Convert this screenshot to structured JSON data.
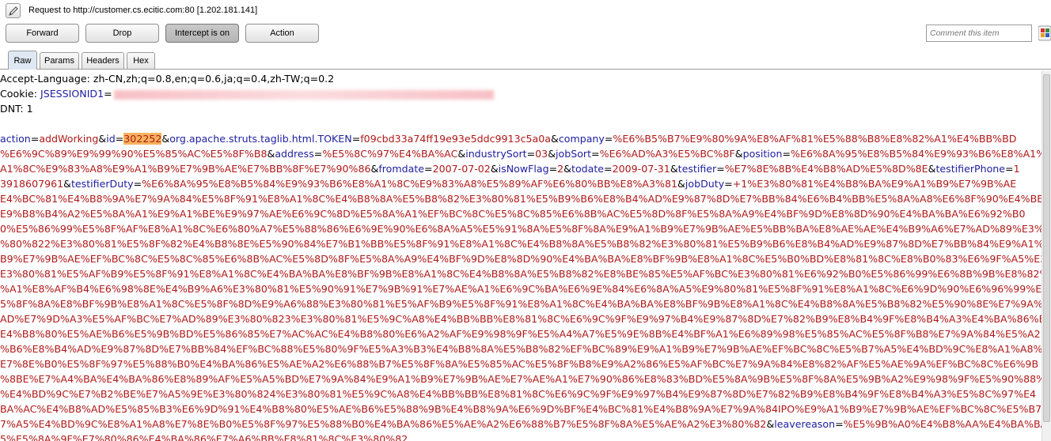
{
  "header": {
    "title": "Request to http://customer.cs.ecitic.com:80  [1.202.181.141]"
  },
  "toolbar": {
    "forward_label": "Forward",
    "drop_label": "Drop",
    "intercept_label": "Intercept is on",
    "action_label": "Action",
    "comment_placeholder": "Comment this item"
  },
  "tabs": [
    {
      "label": "Raw",
      "active": true
    },
    {
      "label": "Params",
      "active": false
    },
    {
      "label": "Headers",
      "active": false
    },
    {
      "label": "Hex",
      "active": false
    }
  ],
  "request": {
    "header_lines": [
      "Accept-Language: zh-CN,zh;q=0.8,en;q=0.6,ja;q=0.4,zh-TW;q=0.2",
      "Cookie: ",
      "DNT: 1"
    ],
    "cookie_name": "JSESSIONID1",
    "cookie_value_redacted": true,
    "highlighted_value": "302252",
    "body_lines": [
      [
        [
          "k",
          "action"
        ],
        [
          "e",
          "="
        ],
        [
          "v",
          "addWorking"
        ],
        [
          "e",
          "&"
        ],
        [
          "k",
          "id"
        ],
        [
          "e",
          "="
        ],
        [
          "h",
          "302252"
        ],
        [
          "e",
          "&"
        ],
        [
          "k",
          "org.apache.struts.taglib.html.TOKEN"
        ],
        [
          "e",
          "="
        ],
        [
          "v",
          "f09cbd33a74ff19e93e5ddc9913c5a0a"
        ],
        [
          "e",
          "&"
        ],
        [
          "k",
          "company"
        ],
        [
          "e",
          "="
        ],
        [
          "v",
          "%E6%B5%B7%E9%80%9A%E8%AF%81%E5%88%B8%E8%82%A1%E4%BB%BD"
        ]
      ],
      [
        [
          "v",
          "%E6%9C%89%E9%99%90%E5%85%AC%E5%8F%B8"
        ],
        [
          "e",
          "&"
        ],
        [
          "k",
          "address"
        ],
        [
          "e",
          "="
        ],
        [
          "v",
          "%E5%8C%97%E4%BA%AC"
        ],
        [
          "e",
          "&"
        ],
        [
          "k",
          "industrySort"
        ],
        [
          "e",
          "="
        ],
        [
          "v",
          "03"
        ],
        [
          "e",
          "&"
        ],
        [
          "k",
          "jobSort"
        ],
        [
          "e",
          "="
        ],
        [
          "v",
          "%E6%AD%A3%E5%BC%8F"
        ],
        [
          "e",
          "&"
        ],
        [
          "k",
          "position"
        ],
        [
          "e",
          "="
        ],
        [
          "v",
          "%E6%8A%95%E8%B5%84%E9%93%B6%E8%A1%8C"
        ]
      ],
      [
        [
          "v",
          "A1%8C%E9%83%A8%E9%A1%B9%E7%9B%AE%E7%BB%8F%E7%90%86"
        ],
        [
          "e",
          "&"
        ],
        [
          "k",
          "fromdate"
        ],
        [
          "e",
          "="
        ],
        [
          "v",
          "2007-07-02"
        ],
        [
          "e",
          "&"
        ],
        [
          "k",
          "isNowFlag"
        ],
        [
          "e",
          "="
        ],
        [
          "v",
          "2"
        ],
        [
          "e",
          "&"
        ],
        [
          "k",
          "todate"
        ],
        [
          "e",
          "="
        ],
        [
          "v",
          "2009-07-31"
        ],
        [
          "e",
          "&"
        ],
        [
          "k",
          "testifier"
        ],
        [
          "e",
          "="
        ],
        [
          "v",
          "%E7%8E%8B%E4%B8%AD%E5%8D%8E"
        ],
        [
          "e",
          "&"
        ],
        [
          "k",
          "testifierPhone"
        ],
        [
          "e",
          "="
        ],
        [
          "v",
          "1"
        ]
      ],
      [
        [
          "v",
          "3918607961"
        ],
        [
          "e",
          "&"
        ],
        [
          "k",
          "testifierDuty"
        ],
        [
          "e",
          "="
        ],
        [
          "v",
          "%E6%8A%95%E8%B5%84%E9%93%B6%E8%A1%8C%E9%83%A8%E5%89%AF%E6%80%BB%E8%A3%81"
        ],
        [
          "e",
          "&"
        ],
        [
          "k",
          "jobDuty"
        ],
        [
          "e",
          "="
        ],
        [
          "v",
          "+1%E3%80%81%E4%B8%BA%E9%A1%B9%E7%9B%AE"
        ]
      ],
      [
        [
          "v",
          "E4%BC%81%E4%B8%9A%E7%9A%84%E5%8F%91%E8%A1%8C%E4%B8%8A%E5%B8%82%E3%80%81%E5%B9%B6%E8%B4%AD%E9%87%8D%E7%BB%84%E6%B4%BB%E5%8A%A8%E6%8F%90%E4%BE%9B"
        ]
      ],
      [
        [
          "v",
          "E9%B8%B4%A2%E5%8A%A1%E9%A1%BE%E9%97%AE%E6%9C%8D%E5%8A%A1%EF%BC%8C%E5%8C%85%E6%8B%AC%E5%8D%8F%E5%8A%A9%E4%BF%9D%E8%8D%90%E4%BA%BA%E6%92%B0"
        ]
      ],
      [
        [
          "v",
          "0%E5%86%99%E5%8F%AF%E8%A1%8C%E6%80%A7%E5%88%86%E6%9E%90%E6%8A%A5%E5%91%8A%E5%8F%8A%E9%A1%B9%E7%9B%AE%E5%BB%BA%E8%AE%AE%E4%B9%A6%E7%AD%89%E3%80"
        ]
      ],
      [
        [
          "v",
          "%80%822%E3%80%81%E5%8F%82%E4%B8%8E%E5%90%84%E7%B1%BB%E5%8F%91%E8%A1%8C%E4%B8%8A%E5%B8%82%E3%80%81%E5%B9%B6%E8%B4%AD%E9%87%8D%E7%BB%84%E9%A1%B9"
        ]
      ],
      [
        [
          "v",
          "B9%E7%9B%AE%EF%BC%8C%E5%8C%85%E6%8B%AC%E5%8D%8F%E5%8A%A9%E4%BF%9D%E8%8D%90%E4%BA%BA%E8%BF%9B%E8%A1%8C%E5%B0%BD%E8%81%8C%E8%B0%83%E6%9F%A5%E3"
        ]
      ],
      [
        [
          "v",
          "E3%80%81%E5%AF%B9%E5%8F%91%E8%A1%8C%E4%BA%BA%E8%BF%9B%E8%A1%8C%E4%B8%8A%E5%B8%82%E8%BE%85%E5%AF%BC%E3%80%81%E6%92%B0%E5%86%99%E6%8B%9B%E8%82%A1"
        ]
      ],
      [
        [
          "v",
          "%A1%E8%AF%B4%E6%98%8E%E4%B9%A6%E3%80%81%E5%90%91%E7%9B%91%E7%AE%A1%E6%9C%BA%E6%9E%84%E6%8A%A5%E9%80%81%E5%8F%91%E8%A1%8C%E6%9D%90%E6%96%99%E5"
        ]
      ],
      [
        [
          "v",
          "5%8F%8A%E8%BF%9B%E8%A1%8C%E5%8F%8D%E9%A6%88%E3%80%81%E5%AF%B9%E5%8F%91%E8%A1%8C%E4%BA%BA%E8%BF%9B%E8%A1%8C%E4%B8%8A%E5%B8%82%E5%90%8E%E7%9A%84"
        ]
      ],
      [
        [
          "v",
          "AD%E7%9D%A3%E5%AF%BC%E7%AD%89%E3%80%823%E3%80%81%E5%9C%A8%E4%BB%BB%E8%81%8C%E6%9C%9F%E9%97%B4%E9%87%8D%E7%82%B9%E8%B4%9F%E8%B4%A3%E4%BA%86%E5"
        ]
      ],
      [
        [
          "v",
          "E4%B8%80%E5%AE%B6%E5%9B%BD%E5%86%85%E7%AC%AC%E4%B8%80%E6%A2%AF%E9%98%9F%E5%A4%A7%E5%9E%8B%E4%BF%A1%E6%89%98%E5%85%AC%E5%8F%B8%E7%9A%84%E5%A2"
        ]
      ],
      [
        [
          "v",
          "%B6%E8%B4%AD%E9%87%8D%E7%BB%84%EF%BC%88%E5%80%9F%E5%A3%B3%E4%B8%8A%E5%B8%82%EF%BC%89%E9%A1%B9%E7%9B%AE%EF%BC%8C%E5%B7%A5%E4%BD%9C%E8%A1%A8%E5"
        ]
      ],
      [
        [
          "v",
          "E7%8E%B0%E5%8F%97%E5%88%B0%E4%BA%86%E5%AE%A2%E6%88%B7%E5%8F%8A%E5%85%AC%E5%8F%B8%E9%A2%86%E5%AF%BC%E7%9A%84%E8%82%AF%E5%AE%9A%EF%BC%8C%E6%9B"
        ]
      ],
      [
        [
          "v",
          "%8BE%E7%A4%BA%E4%BA%86%E8%89%AF%E5%A5%BD%E7%9A%84%E9%A1%B9%E7%9B%AE%E7%AE%A1%E7%90%86%E8%83%BD%E5%8A%9B%E5%8F%8A%E5%9B%A2%E9%98%9F%E5%90%88%E4"
        ]
      ],
      [
        [
          "v",
          "%E4%BD%9C%E7%B2%BE%E7%A5%9E%E3%80%824%E3%80%81%E5%9C%A8%E4%BB%BB%E8%81%8C%E6%9C%9F%E9%97%B4%E9%87%8D%E7%82%B9%E8%B4%9F%E8%B4%A3%E5%8C%97%E4"
        ]
      ],
      [
        [
          "v",
          "BA%AC%E4%B8%AD%E5%85%B3%E6%9D%91%E4%B8%80%E5%AE%B6%E5%88%9B%E4%B8%9A%E6%9D%BF%E4%BC%81%E4%B8%9A%E7%9A%84IPO%E9%A1%B9%E7%9B%AE%EF%BC%8C%E5%B7"
        ]
      ],
      [
        [
          "v",
          "7%A5%E4%BD%9C%E8%A1%A8%E7%8E%B0%E5%8F%97%E5%88%B0%E4%BA%86%E5%AE%A2%E6%88%B7%E5%8F%8A%E5%AE%A2%E3%80%82"
        ],
        [
          "e",
          "&"
        ],
        [
          "k",
          "leavereason"
        ],
        [
          "e",
          "="
        ],
        [
          "v",
          "%E5%9B%A0%E4%B8%AA%E4%BA%BA%E5%8F%91%E5%B1%95%E5%9B%BD%E5%86%85%E5%B8%82%E5%9C%BA"
        ]
      ],
      [
        [
          "v",
          "5%E5%8A%9F%E7%80%86%E4%BA%86%E7%A6%BB%E8%81%8C%E3%80%82"
        ]
      ]
    ]
  },
  "colors": {
    "param_name": "#2020a0",
    "param_value": "#b01818",
    "highlight": "#f5b35e"
  },
  "icons": {
    "edit": "pencil-icon",
    "color_picker": "color-grid-icon"
  }
}
